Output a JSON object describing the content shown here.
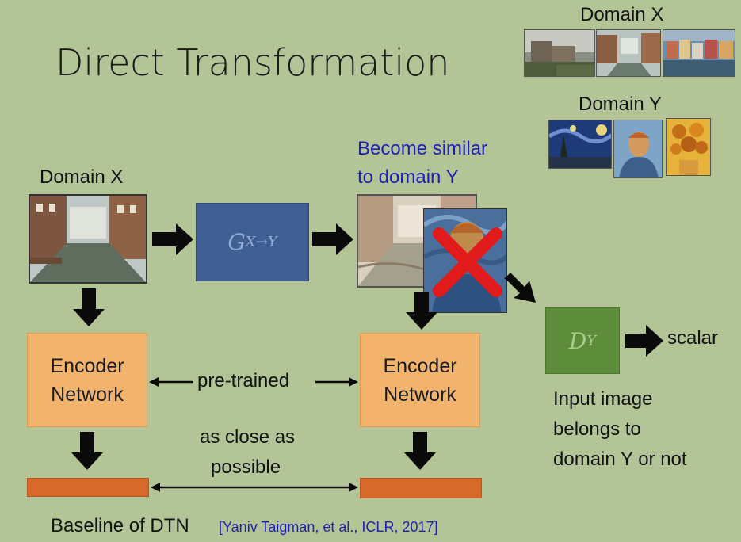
{
  "title": "Direct Transformation",
  "top_right": {
    "domain_x_label": "Domain X",
    "domain_y_label": "Domain Y"
  },
  "input": {
    "label": "Domain X"
  },
  "generator": {
    "symbol": "G",
    "subscript": "X→Y"
  },
  "output": {
    "label_line1": "Become similar",
    "label_line2": "to domain Y"
  },
  "discriminator": {
    "symbol": "D",
    "subscript": "Y",
    "output_label": "scalar",
    "caption_line1": "Input image",
    "caption_line2": "belongs to",
    "caption_line3": "domain Y or not"
  },
  "encoder_left": {
    "label": "Encoder\nNetwork"
  },
  "encoder_right": {
    "label": "Encoder\nNetwork"
  },
  "pretrained_label": "pre-trained",
  "close_label_line1": "as close as",
  "close_label_line2": "possible",
  "footer": {
    "text": "Baseline of DTN",
    "citation": "[Yaniv Taigman, et al., ICLR, 2017]"
  },
  "colors": {
    "background": "#b3c597",
    "encoder": "#f2b36c",
    "code": "#d7692a",
    "generator": "#3f5f95",
    "discriminator": "#5d8d3a",
    "highlight_text": "#1f1fb8",
    "reject_mark": "#e11b1b"
  }
}
